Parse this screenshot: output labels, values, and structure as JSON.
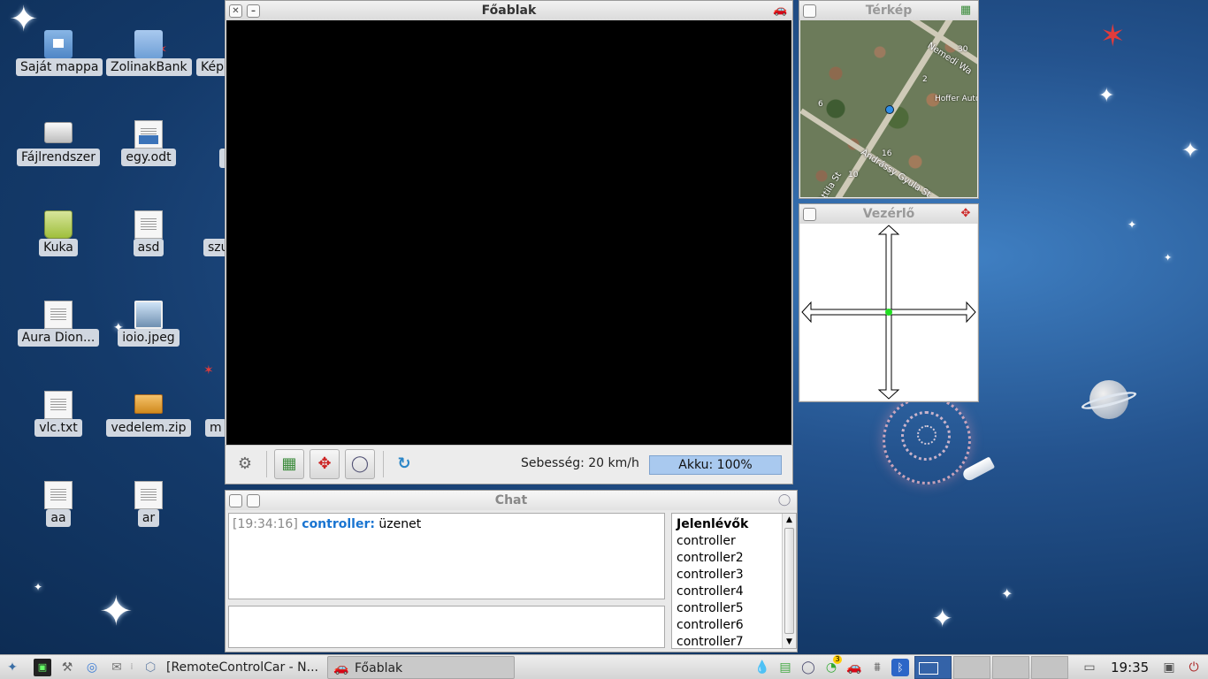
{
  "desktop": {
    "icons": [
      {
        "label": "Saját mappa",
        "icon": "home-folder-icon"
      },
      {
        "label": "ZolinakBank",
        "icon": "folder-icon"
      },
      {
        "label": "Kép",
        "icon": "folder-icon"
      },
      {
        "label": "Fájlrendszer",
        "icon": "drive-icon"
      },
      {
        "label": "egy.odt",
        "icon": "odt-document-icon"
      },
      {
        "label": "Kuka",
        "icon": "trash-icon"
      },
      {
        "label": "asd",
        "icon": "text-file-icon"
      },
      {
        "label": "szu",
        "icon": "text-file-icon"
      },
      {
        "label": "Aura Dion...",
        "icon": "text-file-icon"
      },
      {
        "label": "ioio.jpeg",
        "icon": "image-file-icon"
      },
      {
        "label": "vlc.txt",
        "icon": "text-file-icon"
      },
      {
        "label": "vedelem.zip",
        "icon": "archive-icon"
      },
      {
        "label": "m",
        "icon": "file-icon"
      },
      {
        "label": "aa",
        "icon": "text-file-icon"
      },
      {
        "label": "ar",
        "icon": "text-file-icon"
      }
    ]
  },
  "main_window": {
    "title": "Főablak",
    "speed_label": "Sebesség: 20 km/h",
    "battery_label": "Akku: 100%",
    "battery_level": 1.0,
    "toolbar_icons": [
      "car-settings-icon",
      "map-icon",
      "move-arrows-icon",
      "chat-bubble-icon",
      "refresh-icon"
    ]
  },
  "map_window": {
    "title": "Térkép",
    "street_labels": [
      "Nemedi Wa",
      "Hoffer Auto",
      "Andrássy Gyula St",
      "Attila St",
      "30",
      "16",
      "10",
      "6",
      "2"
    ]
  },
  "control_window": {
    "title": "Vezérlő"
  },
  "chat_window": {
    "title": "Chat",
    "messages": [
      {
        "time": "[19:34:16]",
        "user": "controller:",
        "text": "üzenet"
      }
    ],
    "input_value": "",
    "presence_title": "Jelenlévők",
    "presence_list": [
      "controller",
      "controller2",
      "controller3",
      "controller4",
      "controller5",
      "controller6",
      "controller7"
    ]
  },
  "taskbar": {
    "tasks": [
      {
        "label": "[RemoteControlCar - N...",
        "active": false
      },
      {
        "label": "Főablak",
        "active": true
      }
    ],
    "clock": "19:35",
    "tray_badge": "3"
  },
  "colors": {
    "chat_user": "#1a75d1",
    "battery_fill": "#a9c9ef",
    "control_dot": "#22dd22",
    "map_pin": "#2e8de6"
  }
}
